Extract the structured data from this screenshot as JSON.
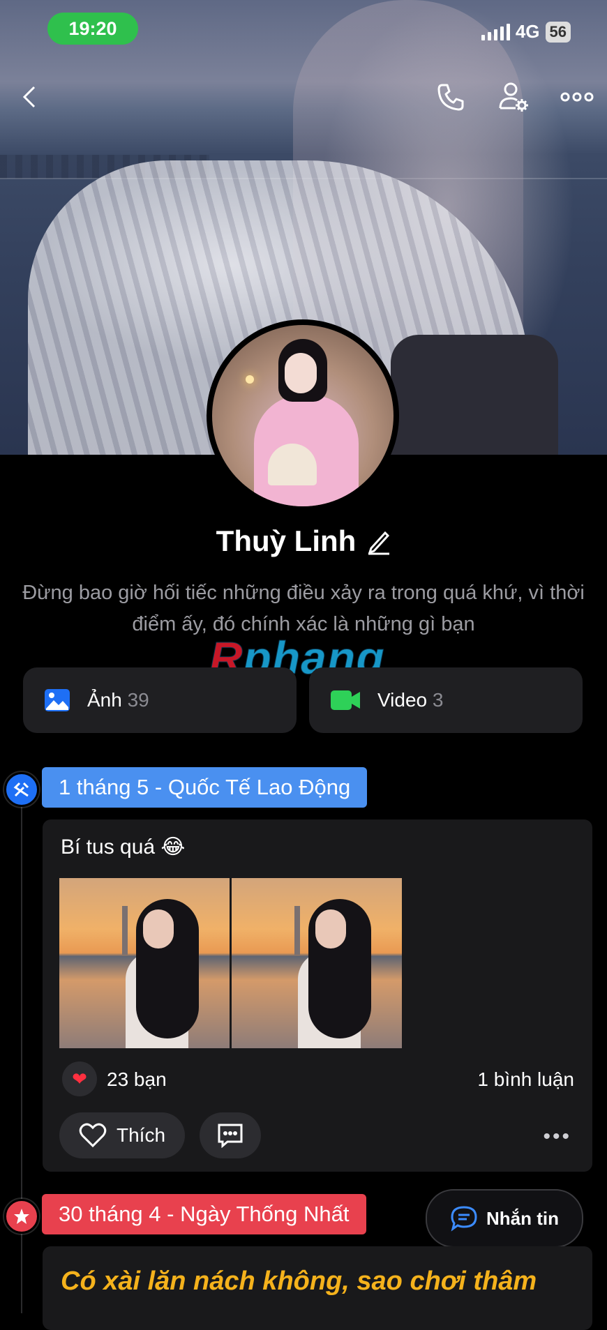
{
  "status_bar": {
    "time": "19:20",
    "network": "4G",
    "battery": "56"
  },
  "profile": {
    "name": "Thuỳ Linh",
    "bio": "Đừng bao giờ hối tiếc những điều xảy ra trong quá khứ, vì thời điểm ấy, đó chính xác là những gì bạn"
  },
  "watermark": {
    "first": "R",
    "rest": "phang"
  },
  "media": [
    {
      "label": "Ảnh",
      "count": "39"
    },
    {
      "label": "Video",
      "count": "3"
    }
  ],
  "posts": [
    {
      "tag": "1 tháng 5 - Quốc Tế Lao Động",
      "tag_color": "#4a90f0",
      "text": "Bí tus quá 😂",
      "likes": "23 bạn",
      "comments": "1 bình luận",
      "like_label": "Thích"
    },
    {
      "tag": "30 tháng 4 - Ngày Thống Nhất",
      "tag_color": "#e8414e",
      "text": "Có xài lăn nách không, sao chơi thâm"
    }
  ],
  "message_button": "Nhắn tin",
  "colors": {
    "accent_blue": "#1e6ff5",
    "video_green": "#2ed158",
    "status_green": "#2fc04d",
    "post_text_yellow": "#f5b21c"
  }
}
